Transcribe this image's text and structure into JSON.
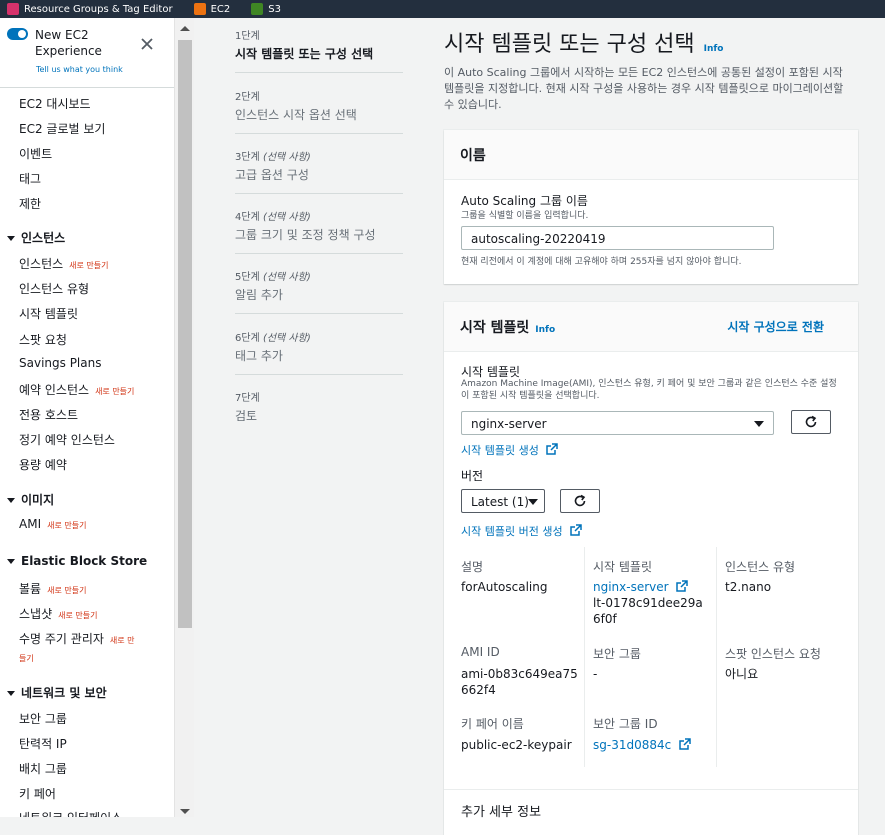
{
  "topbar": {
    "items": [
      {
        "label": "Resource Groups & Tag Editor",
        "icon": "resource-groups-icon",
        "color": "#d6326b"
      },
      {
        "label": "EC2",
        "icon": "ec2-icon",
        "color": "#ec7211"
      },
      {
        "label": "S3",
        "icon": "s3-icon",
        "color": "#3f8624"
      }
    ]
  },
  "sidebar": {
    "new_experience_line1": "New EC2",
    "new_experience_line2": "Experience",
    "feedback_link": "Tell us what you think",
    "top_items": [
      "EC2 대시보드",
      "EC2 글로벌 보기",
      "이벤트",
      "태그",
      "제한"
    ],
    "sections": [
      {
        "title": "인스턴스",
        "items": [
          {
            "label": "인스턴스",
            "badge": "새로 만들기"
          },
          {
            "label": "인스턴스 유형",
            "badge": ""
          },
          {
            "label": "시작 템플릿",
            "badge": ""
          },
          {
            "label": "스팟 요청",
            "badge": ""
          },
          {
            "label": "Savings Plans",
            "badge": ""
          },
          {
            "label": "예약 인스턴스",
            "badge": "새로 만들기"
          },
          {
            "label": "전용 호스트",
            "badge": ""
          },
          {
            "label": "정기 예약 인스턴스",
            "badge": ""
          },
          {
            "label": "용량 예약",
            "badge": ""
          }
        ]
      },
      {
        "title": "이미지",
        "items": [
          {
            "label": "AMI",
            "badge": "새로 만들기"
          }
        ]
      },
      {
        "title": "Elastic Block Store",
        "items": [
          {
            "label": "볼륨",
            "badge": "새로 만들기"
          },
          {
            "label": "스냅샷",
            "badge": "새로 만들기"
          },
          {
            "label": "수명 주기 관리자",
            "badge_line1": "새로 만",
            "badge_line2": "들기"
          }
        ]
      },
      {
        "title": "네트워크 및 보안",
        "items": [
          {
            "label": "보안 그룹"
          },
          {
            "label": "탄력적 IP"
          },
          {
            "label": "배치 그룹"
          },
          {
            "label": "키 페어"
          },
          {
            "label": "네트워크 인터페이스"
          }
        ]
      }
    ]
  },
  "steps": [
    {
      "num": "1단계",
      "optional": "",
      "title": "시작 템플릿 또는 구성 선택",
      "active": true
    },
    {
      "num": "2단계",
      "optional": "",
      "title": "인스턴스 시작 옵션 선택",
      "active": false
    },
    {
      "num": "3단계",
      "optional": "(선택 사항)",
      "title": "고급 옵션 구성",
      "active": false
    },
    {
      "num": "4단계",
      "optional": "(선택 사항)",
      "title": "그룹 크기 및 조정 정책 구성",
      "active": false
    },
    {
      "num": "5단계",
      "optional": "(선택 사항)",
      "title": "알림 추가",
      "active": false
    },
    {
      "num": "6단계",
      "optional": "(선택 사항)",
      "title": "태그 추가",
      "active": false
    },
    {
      "num": "7단계",
      "optional": "",
      "title": "검토",
      "active": false
    }
  ],
  "page": {
    "title": "시작 템플릿 또는 구성 선택",
    "info": "Info",
    "description": "이 Auto Scaling 그룹에서 시작하는 모든 EC2 인스턴스에 공통된 설정이 포함된 시작 템플릿을 지정합니다. 현재 시작 구성을 사용하는 경우 시작 템플릿으로 마이그레이션할 수 있습니다."
  },
  "name_card": {
    "header": "이름",
    "field_label": "Auto Scaling 그룹 이름",
    "field_desc": "그룹을 식별할 이름을 입력합니다.",
    "field_value": "autoscaling-20220419",
    "field_hint": "현재 리전에서 이 계정에 대해 고유해야 하며 255자를 넘지 않아야 합니다."
  },
  "template_card": {
    "header": "시작 템플릿",
    "info": "Info",
    "switch_link": "시작 구성으로 전환",
    "template_label": "시작 템플릿",
    "template_desc": "Amazon Machine Image(AMI), 인스턴스 유형, 키 페어 및 보안 그룹과 같은 인스턴스 수준 설정이 포함된 시작 템플릿을 선택합니다.",
    "template_value": "nginx-server",
    "create_template_link": "시작 템플릿 생성",
    "version_label": "버전",
    "version_value": "Latest (1)",
    "create_version_link": "시작 템플릿 버전 생성",
    "details": {
      "description_label": "설명",
      "description_value": "forAutoscaling",
      "template_label": "시작 템플릿",
      "template_link": "nginx-server",
      "template_id": "lt-0178c91dee29a6f0f",
      "instance_type_label": "인스턴스 유형",
      "instance_type_value": "t2.nano",
      "ami_label": "AMI ID",
      "ami_value": "ami-0b83c649ea75662f4",
      "sg_label": "보안 그룹",
      "sg_value": "-",
      "spot_label": "스팟 인스턴스 요청",
      "spot_value": "아니요",
      "keypair_label": "키 페어 이름",
      "keypair_value": "public-ec2-keypair",
      "sgid_label": "보안 그룹 ID",
      "sgid_value": "sg-31d0884c"
    },
    "more_details": "추가 세부 정보"
  }
}
